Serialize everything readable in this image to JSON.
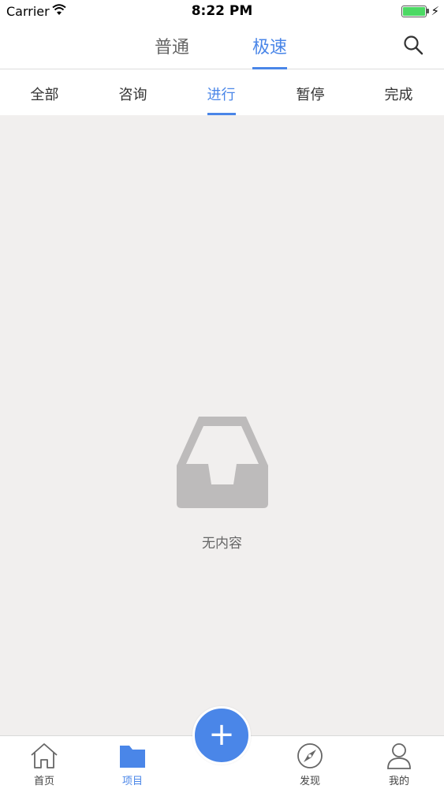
{
  "status_bar": {
    "carrier": "Carrier",
    "time": "8:22 PM"
  },
  "header": {
    "modes": [
      {
        "label": "普通",
        "active": false
      },
      {
        "label": "极速",
        "active": true
      }
    ],
    "search_icon": "search-icon"
  },
  "filter_tabs": [
    {
      "label": "全部"
    },
    {
      "label": "咨询"
    },
    {
      "label": "进行",
      "active": true
    },
    {
      "label": "暂停"
    },
    {
      "label": "完成"
    }
  ],
  "empty_state": {
    "icon": "inbox-tray-icon",
    "text": "无内容"
  },
  "tab_bar": {
    "items": [
      {
        "label": "首页",
        "icon": "home-icon"
      },
      {
        "label": "项目",
        "icon": "folder-icon",
        "active": true
      },
      {
        "label": "发现",
        "icon": "compass-icon"
      },
      {
        "label": "我的",
        "icon": "user-icon"
      }
    ],
    "fab_label": "+"
  },
  "colors": {
    "accent": "#4a86e8",
    "background": "#f1efee",
    "battery": "#4cd964"
  }
}
